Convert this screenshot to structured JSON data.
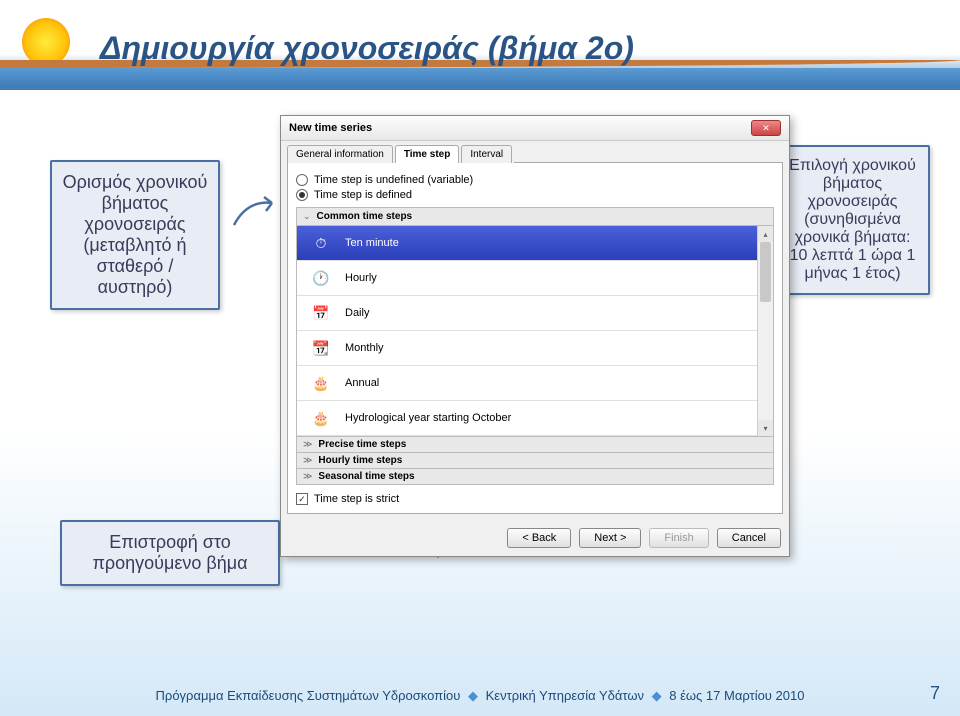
{
  "page": {
    "title": "Δημιουργία χρονοσειράς (βήμα 2ο)"
  },
  "callouts": {
    "left": "Ορισμός χρονικού βήματος χρονοσειράς (μεταβλητό ή σταθερό / αυστηρό)",
    "right": "Επιλογή χρονικού βήματος χρονοσειράς (συνηθισμένα χρονικά βήματα: 10 λεπτά 1 ώρα 1 μήνας 1 έτος)",
    "bottom": "Επιστροφή στο προηγούμενο βήμα"
  },
  "dialog": {
    "title": "New time series",
    "tabs": {
      "general": "General information",
      "timestep": "Time step",
      "interval": "Interval"
    },
    "radios": {
      "undefined": "Time step is undefined (variable)",
      "defined": "Time step is defined"
    },
    "section_common": "Common time steps",
    "items": {
      "ten": "Ten minute",
      "hourly": "Hourly",
      "daily": "Daily",
      "monthly": "Monthly",
      "annual": "Annual",
      "hydro": "Hydrological year starting October"
    },
    "subsections": {
      "precise": "Precise time steps",
      "hourlysteps": "Hourly time steps",
      "seasonal": "Seasonal time steps"
    },
    "strict_label": "Time step is strict",
    "buttons": {
      "back": "< Back",
      "next": "Next >",
      "finish": "Finish",
      "cancel": "Cancel"
    }
  },
  "footer": {
    "left": "Πρόγραμμα Εκπαίδευσης Συστημάτων Υδροσκοπίου",
    "mid": "Κεντρική Υπηρεσία Υδάτων",
    "right": "8 έως 17 Μαρτίου 2010",
    "pagenum": "7"
  }
}
